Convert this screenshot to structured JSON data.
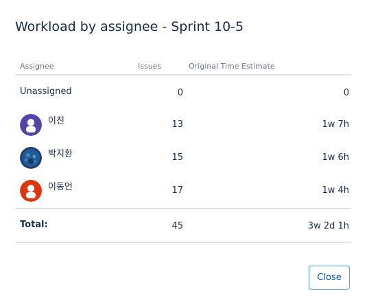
{
  "dialog": {
    "title": "Workload by assignee - Sprint 10-5"
  },
  "table": {
    "headers": {
      "assignee": "Assignee",
      "issues": "Issues",
      "estimate": "Original Time Estimate"
    },
    "rows": [
      {
        "name": "Unassigned",
        "issues": "0",
        "estimate": "0",
        "avatar": "none"
      },
      {
        "name": "이진",
        "issues": "13",
        "estimate": "1w 7h",
        "avatar": "user-icon",
        "avatar_color": "#5243aa"
      },
      {
        "name": "박지환",
        "issues": "15",
        "estimate": "1w 6h",
        "avatar": "photo",
        "avatar_color": "#1c3d6b"
      },
      {
        "name": "이동언",
        "issues": "17",
        "estimate": "1w 4h",
        "avatar": "user-icon",
        "avatar_color": "#de350b"
      }
    ],
    "total": {
      "label": "Total:",
      "issues": "45",
      "estimate": "3w 2d 1h"
    }
  },
  "footer": {
    "close_label": "Close"
  },
  "colors": {
    "accent": "#0052cc",
    "focus_border": "#4c9aff",
    "divider": "#dfe1e6",
    "header_text": "#6b778c"
  }
}
